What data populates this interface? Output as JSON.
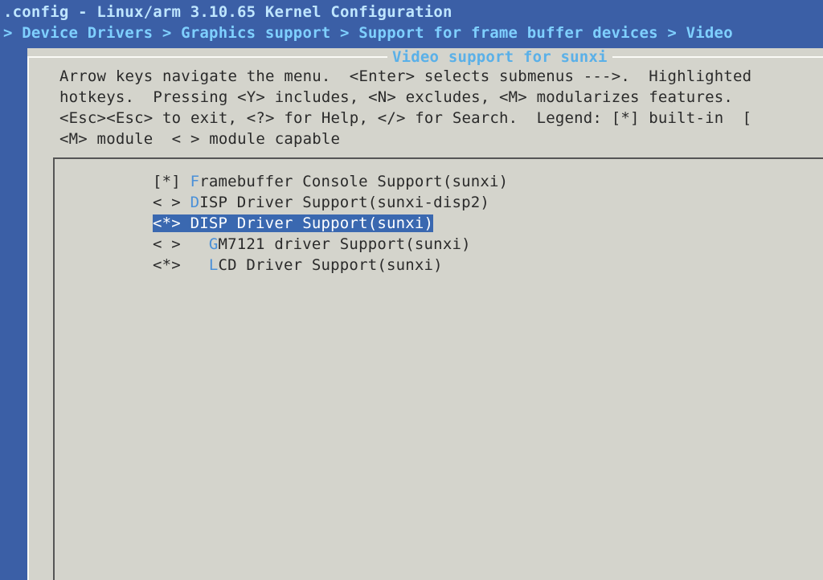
{
  "window": {
    "title": ".config - Linux/arm 3.10.65 Kernel Configuration",
    "breadcrumb": "> Device Drivers > Graphics support > Support for frame buffer devices > Video"
  },
  "dialog": {
    "title": "Video support for sunxi",
    "help_lines": [
      "Arrow keys navigate the menu.  <Enter> selects submenus --->.  Highlighted",
      "hotkeys.  Pressing <Y> includes, <N> excludes, <M> modularizes features.",
      "<Esc><Esc> to exit, <?> for Help, </> for Search.  Legend: [*] built-in  [",
      "<M> module  < > module capable"
    ]
  },
  "menu": {
    "items": [
      {
        "marker": "[*]",
        "indent": "",
        "hotkey": "F",
        "rest": "ramebuffer Console Support(sunxi)",
        "selected": false
      },
      {
        "marker": "< >",
        "indent": "",
        "hotkey": "D",
        "rest": "ISP Driver Support(sunxi-disp2)",
        "selected": false
      },
      {
        "marker": "<*>",
        "indent": "",
        "hotkey": "D",
        "rest": "ISP Driver Support(sunxi)",
        "selected": true
      },
      {
        "marker": "< >",
        "indent": "  ",
        "hotkey": "G",
        "rest": "M7121 driver Support(sunxi)",
        "selected": false
      },
      {
        "marker": "<*>",
        "indent": "  ",
        "hotkey": "L",
        "rest": "CD Driver Support(sunxi)",
        "selected": false
      }
    ]
  },
  "colors": {
    "background": "#3b5fa6",
    "dialog": "#d4d4cc",
    "highlight": "#3a68b0",
    "hotkey": "#4a90d8"
  }
}
